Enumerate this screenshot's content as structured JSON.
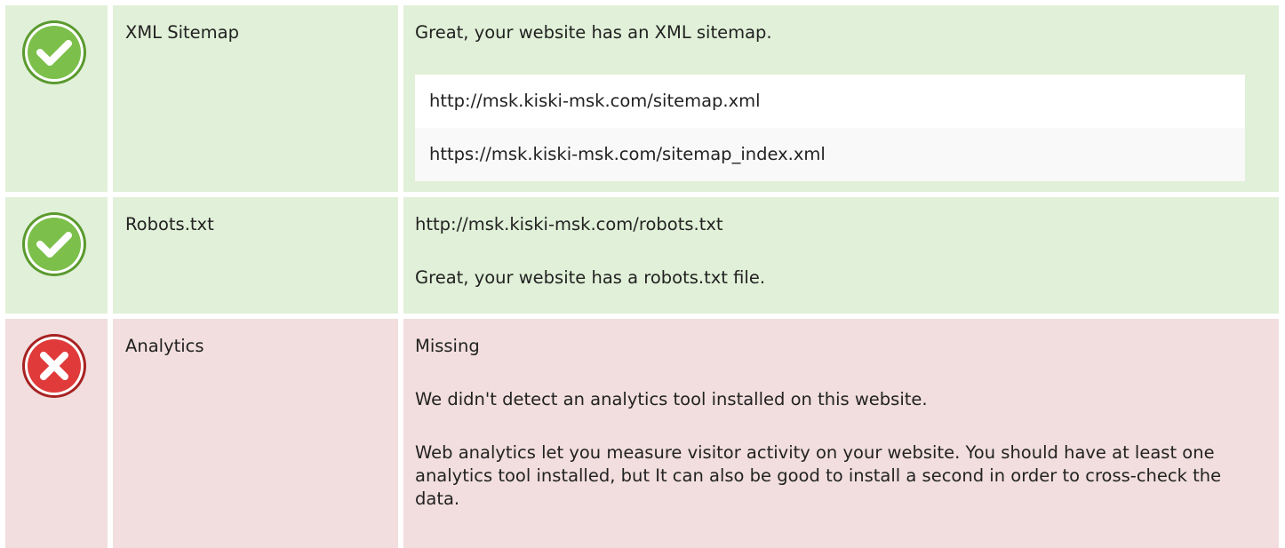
{
  "colors": {
    "pass_bg": "#e1f0d8",
    "fail_bg": "#f2dede",
    "pass_icon": "#7cc04b",
    "fail_icon": "#e03a3a"
  },
  "rows": [
    {
      "status": "pass",
      "icon": "check-circle-icon",
      "name": "XML Sitemap",
      "message": "Great, your website has an XML sitemap.",
      "sitemaps": [
        "http://msk.kiski-msk.com/sitemap.xml",
        "https://msk.kiski-msk.com/sitemap_index.xml"
      ]
    },
    {
      "status": "pass",
      "icon": "check-circle-icon",
      "name": "Robots.txt",
      "url": "http://msk.kiski-msk.com/robots.txt",
      "message": "Great, your website has a robots.txt file."
    },
    {
      "status": "fail",
      "icon": "x-circle-icon",
      "name": "Analytics",
      "value": "Missing",
      "message": "We didn't detect an analytics tool installed on this website.",
      "advice": "Web analytics let you measure visitor activity on your website. You should have at least one analytics tool installed, but It can also be good to install a second in order to cross-check the data."
    }
  ]
}
